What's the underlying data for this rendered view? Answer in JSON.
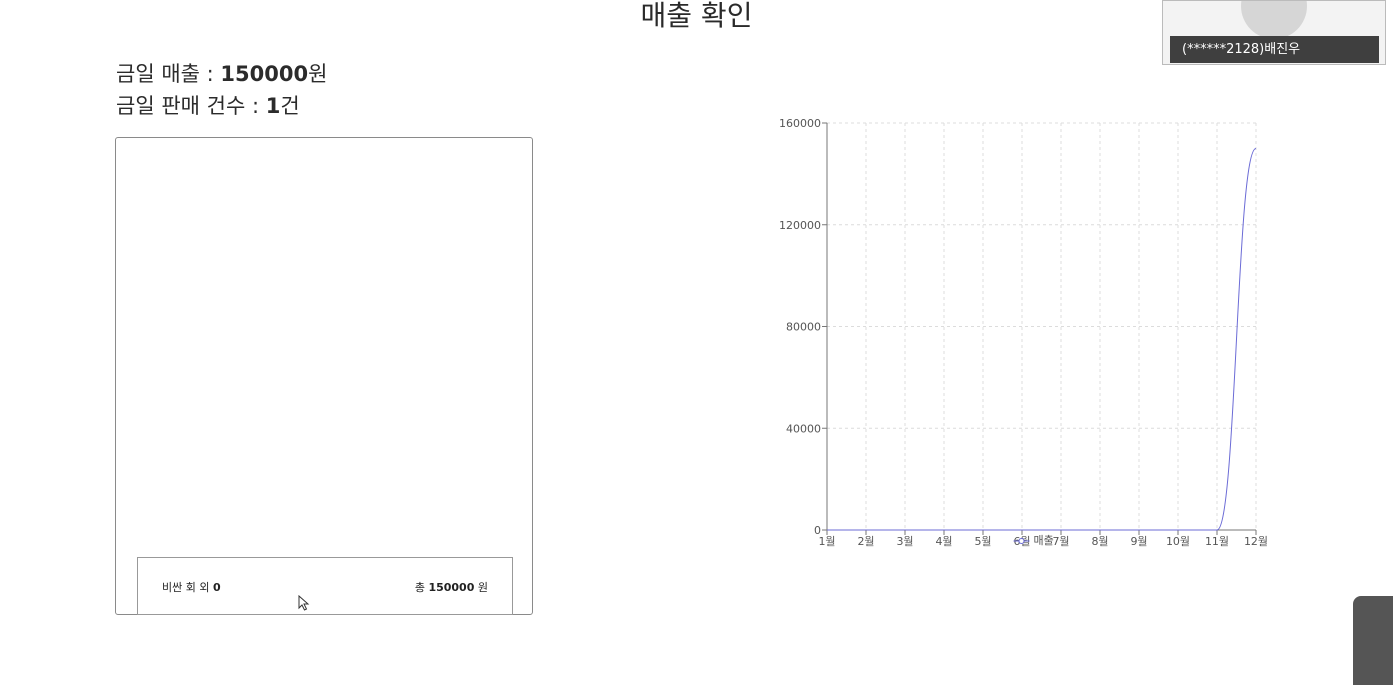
{
  "page": {
    "title": "매출 확인"
  },
  "summary": {
    "sales_label": "금일 매출 : ",
    "sales_value": "150000",
    "sales_unit": "원",
    "count_label": "금일 판매 건수 : ",
    "count_value": "1",
    "count_unit": "건"
  },
  "footer": {
    "left_label": "비싼 회 외",
    "left_value": "0",
    "right_label": "총",
    "right_value": "150000",
    "right_unit": "원"
  },
  "video": {
    "participant_name": "(******2128)배진우"
  },
  "chart_data": {
    "type": "line",
    "categories": [
      "1월",
      "2월",
      "3월",
      "4월",
      "5월",
      "6월",
      "7월",
      "8월",
      "9월",
      "10월",
      "11월",
      "12월"
    ],
    "series": [
      {
        "name": "매출",
        "values": [
          0,
          0,
          0,
          0,
          0,
          0,
          0,
          0,
          0,
          0,
          0,
          150000
        ],
        "color": "#6b6bd6"
      }
    ],
    "y_ticks": [
      "0",
      "40000",
      "80000",
      "120000",
      "160000"
    ],
    "ylim": [
      0,
      160000
    ],
    "grid": true,
    "legend_placement": "bottom-center"
  }
}
